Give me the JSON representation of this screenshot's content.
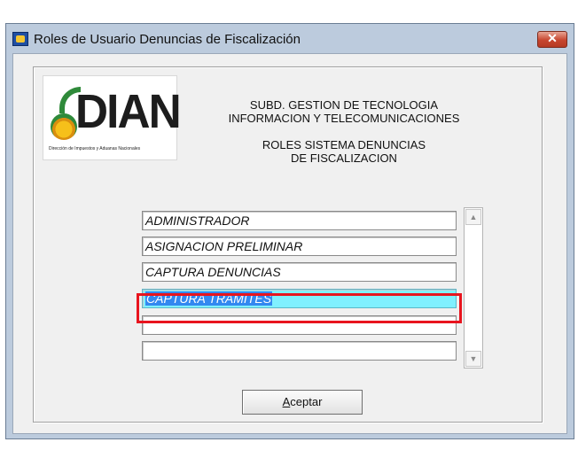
{
  "window": {
    "title": "Roles de Usuario  Denuncias  de Fiscalización",
    "close_label": "✕"
  },
  "logo": {
    "word": "DIAN",
    "subtitle": "Dirección de Impuestos y Aduanas Nacionales"
  },
  "header": {
    "line1": "SUBD. GESTION DE TECNOLOGIA",
    "line2": "INFORMACION Y TELECOMUNICACIONES",
    "line3": "ROLES SISTEMA DENUNCIAS",
    "line4": "DE FISCALIZACION"
  },
  "roles": {
    "items": [
      {
        "label": "ADMINISTRADOR"
      },
      {
        "label": "ASIGNACION PRELIMINAR"
      },
      {
        "label": "CAPTURA DENUNCIAS"
      },
      {
        "label": "CAPTURA TRAMITES"
      },
      {
        "label": ""
      },
      {
        "label": ""
      }
    ],
    "selected_index": 3
  },
  "scrollbar": {
    "up_icon": "scroll-up-icon",
    "down_icon": "scroll-down-icon"
  },
  "buttons": {
    "ok_accel": "A",
    "ok_rest": "ceptar"
  },
  "colors": {
    "selected_row": "#80f0ff",
    "selected_text_bg": "#3388f0",
    "highlight_border": "#e8141e"
  }
}
